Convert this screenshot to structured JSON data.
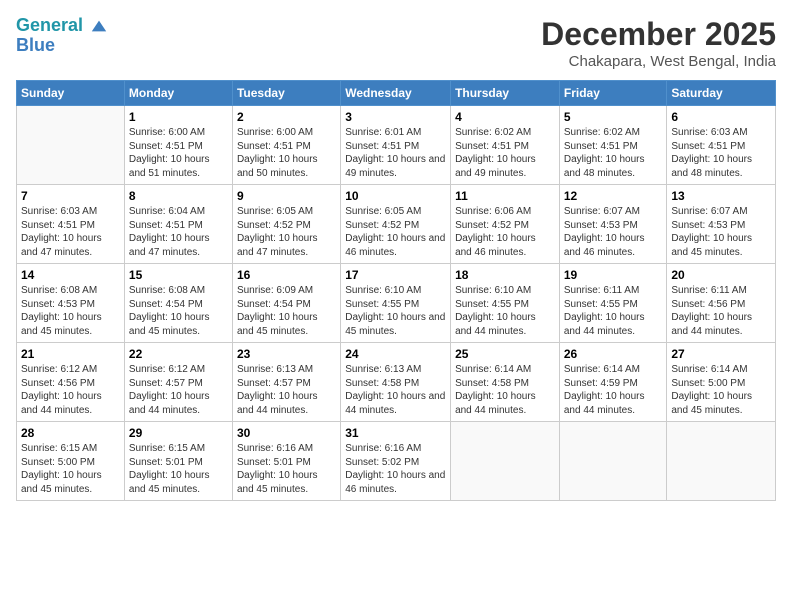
{
  "header": {
    "logo_line1": "General",
    "logo_line2": "Blue",
    "month": "December 2025",
    "location": "Chakapara, West Bengal, India"
  },
  "days_of_week": [
    "Sunday",
    "Monday",
    "Tuesday",
    "Wednesday",
    "Thursday",
    "Friday",
    "Saturday"
  ],
  "weeks": [
    [
      {
        "day": "",
        "empty": true
      },
      {
        "day": "1",
        "sunrise": "6:00 AM",
        "sunset": "4:51 PM",
        "daylight": "10 hours and 51 minutes."
      },
      {
        "day": "2",
        "sunrise": "6:00 AM",
        "sunset": "4:51 PM",
        "daylight": "10 hours and 50 minutes."
      },
      {
        "day": "3",
        "sunrise": "6:01 AM",
        "sunset": "4:51 PM",
        "daylight": "10 hours and 49 minutes."
      },
      {
        "day": "4",
        "sunrise": "6:02 AM",
        "sunset": "4:51 PM",
        "daylight": "10 hours and 49 minutes."
      },
      {
        "day": "5",
        "sunrise": "6:02 AM",
        "sunset": "4:51 PM",
        "daylight": "10 hours and 48 minutes."
      },
      {
        "day": "6",
        "sunrise": "6:03 AM",
        "sunset": "4:51 PM",
        "daylight": "10 hours and 48 minutes."
      }
    ],
    [
      {
        "day": "7",
        "sunrise": "6:03 AM",
        "sunset": "4:51 PM",
        "daylight": "10 hours and 47 minutes."
      },
      {
        "day": "8",
        "sunrise": "6:04 AM",
        "sunset": "4:51 PM",
        "daylight": "10 hours and 47 minutes."
      },
      {
        "day": "9",
        "sunrise": "6:05 AM",
        "sunset": "4:52 PM",
        "daylight": "10 hours and 47 minutes."
      },
      {
        "day": "10",
        "sunrise": "6:05 AM",
        "sunset": "4:52 PM",
        "daylight": "10 hours and 46 minutes."
      },
      {
        "day": "11",
        "sunrise": "6:06 AM",
        "sunset": "4:52 PM",
        "daylight": "10 hours and 46 minutes."
      },
      {
        "day": "12",
        "sunrise": "6:07 AM",
        "sunset": "4:53 PM",
        "daylight": "10 hours and 46 minutes."
      },
      {
        "day": "13",
        "sunrise": "6:07 AM",
        "sunset": "4:53 PM",
        "daylight": "10 hours and 45 minutes."
      }
    ],
    [
      {
        "day": "14",
        "sunrise": "6:08 AM",
        "sunset": "4:53 PM",
        "daylight": "10 hours and 45 minutes."
      },
      {
        "day": "15",
        "sunrise": "6:08 AM",
        "sunset": "4:54 PM",
        "daylight": "10 hours and 45 minutes."
      },
      {
        "day": "16",
        "sunrise": "6:09 AM",
        "sunset": "4:54 PM",
        "daylight": "10 hours and 45 minutes."
      },
      {
        "day": "17",
        "sunrise": "6:10 AM",
        "sunset": "4:55 PM",
        "daylight": "10 hours and 45 minutes."
      },
      {
        "day": "18",
        "sunrise": "6:10 AM",
        "sunset": "4:55 PM",
        "daylight": "10 hours and 44 minutes."
      },
      {
        "day": "19",
        "sunrise": "6:11 AM",
        "sunset": "4:55 PM",
        "daylight": "10 hours and 44 minutes."
      },
      {
        "day": "20",
        "sunrise": "6:11 AM",
        "sunset": "4:56 PM",
        "daylight": "10 hours and 44 minutes."
      }
    ],
    [
      {
        "day": "21",
        "sunrise": "6:12 AM",
        "sunset": "4:56 PM",
        "daylight": "10 hours and 44 minutes."
      },
      {
        "day": "22",
        "sunrise": "6:12 AM",
        "sunset": "4:57 PM",
        "daylight": "10 hours and 44 minutes."
      },
      {
        "day": "23",
        "sunrise": "6:13 AM",
        "sunset": "4:57 PM",
        "daylight": "10 hours and 44 minutes."
      },
      {
        "day": "24",
        "sunrise": "6:13 AM",
        "sunset": "4:58 PM",
        "daylight": "10 hours and 44 minutes."
      },
      {
        "day": "25",
        "sunrise": "6:14 AM",
        "sunset": "4:58 PM",
        "daylight": "10 hours and 44 minutes."
      },
      {
        "day": "26",
        "sunrise": "6:14 AM",
        "sunset": "4:59 PM",
        "daylight": "10 hours and 44 minutes."
      },
      {
        "day": "27",
        "sunrise": "6:14 AM",
        "sunset": "5:00 PM",
        "daylight": "10 hours and 45 minutes."
      }
    ],
    [
      {
        "day": "28",
        "sunrise": "6:15 AM",
        "sunset": "5:00 PM",
        "daylight": "10 hours and 45 minutes."
      },
      {
        "day": "29",
        "sunrise": "6:15 AM",
        "sunset": "5:01 PM",
        "daylight": "10 hours and 45 minutes."
      },
      {
        "day": "30",
        "sunrise": "6:16 AM",
        "sunset": "5:01 PM",
        "daylight": "10 hours and 45 minutes."
      },
      {
        "day": "31",
        "sunrise": "6:16 AM",
        "sunset": "5:02 PM",
        "daylight": "10 hours and 46 minutes."
      },
      {
        "day": "",
        "empty": true
      },
      {
        "day": "",
        "empty": true
      },
      {
        "day": "",
        "empty": true
      }
    ]
  ]
}
